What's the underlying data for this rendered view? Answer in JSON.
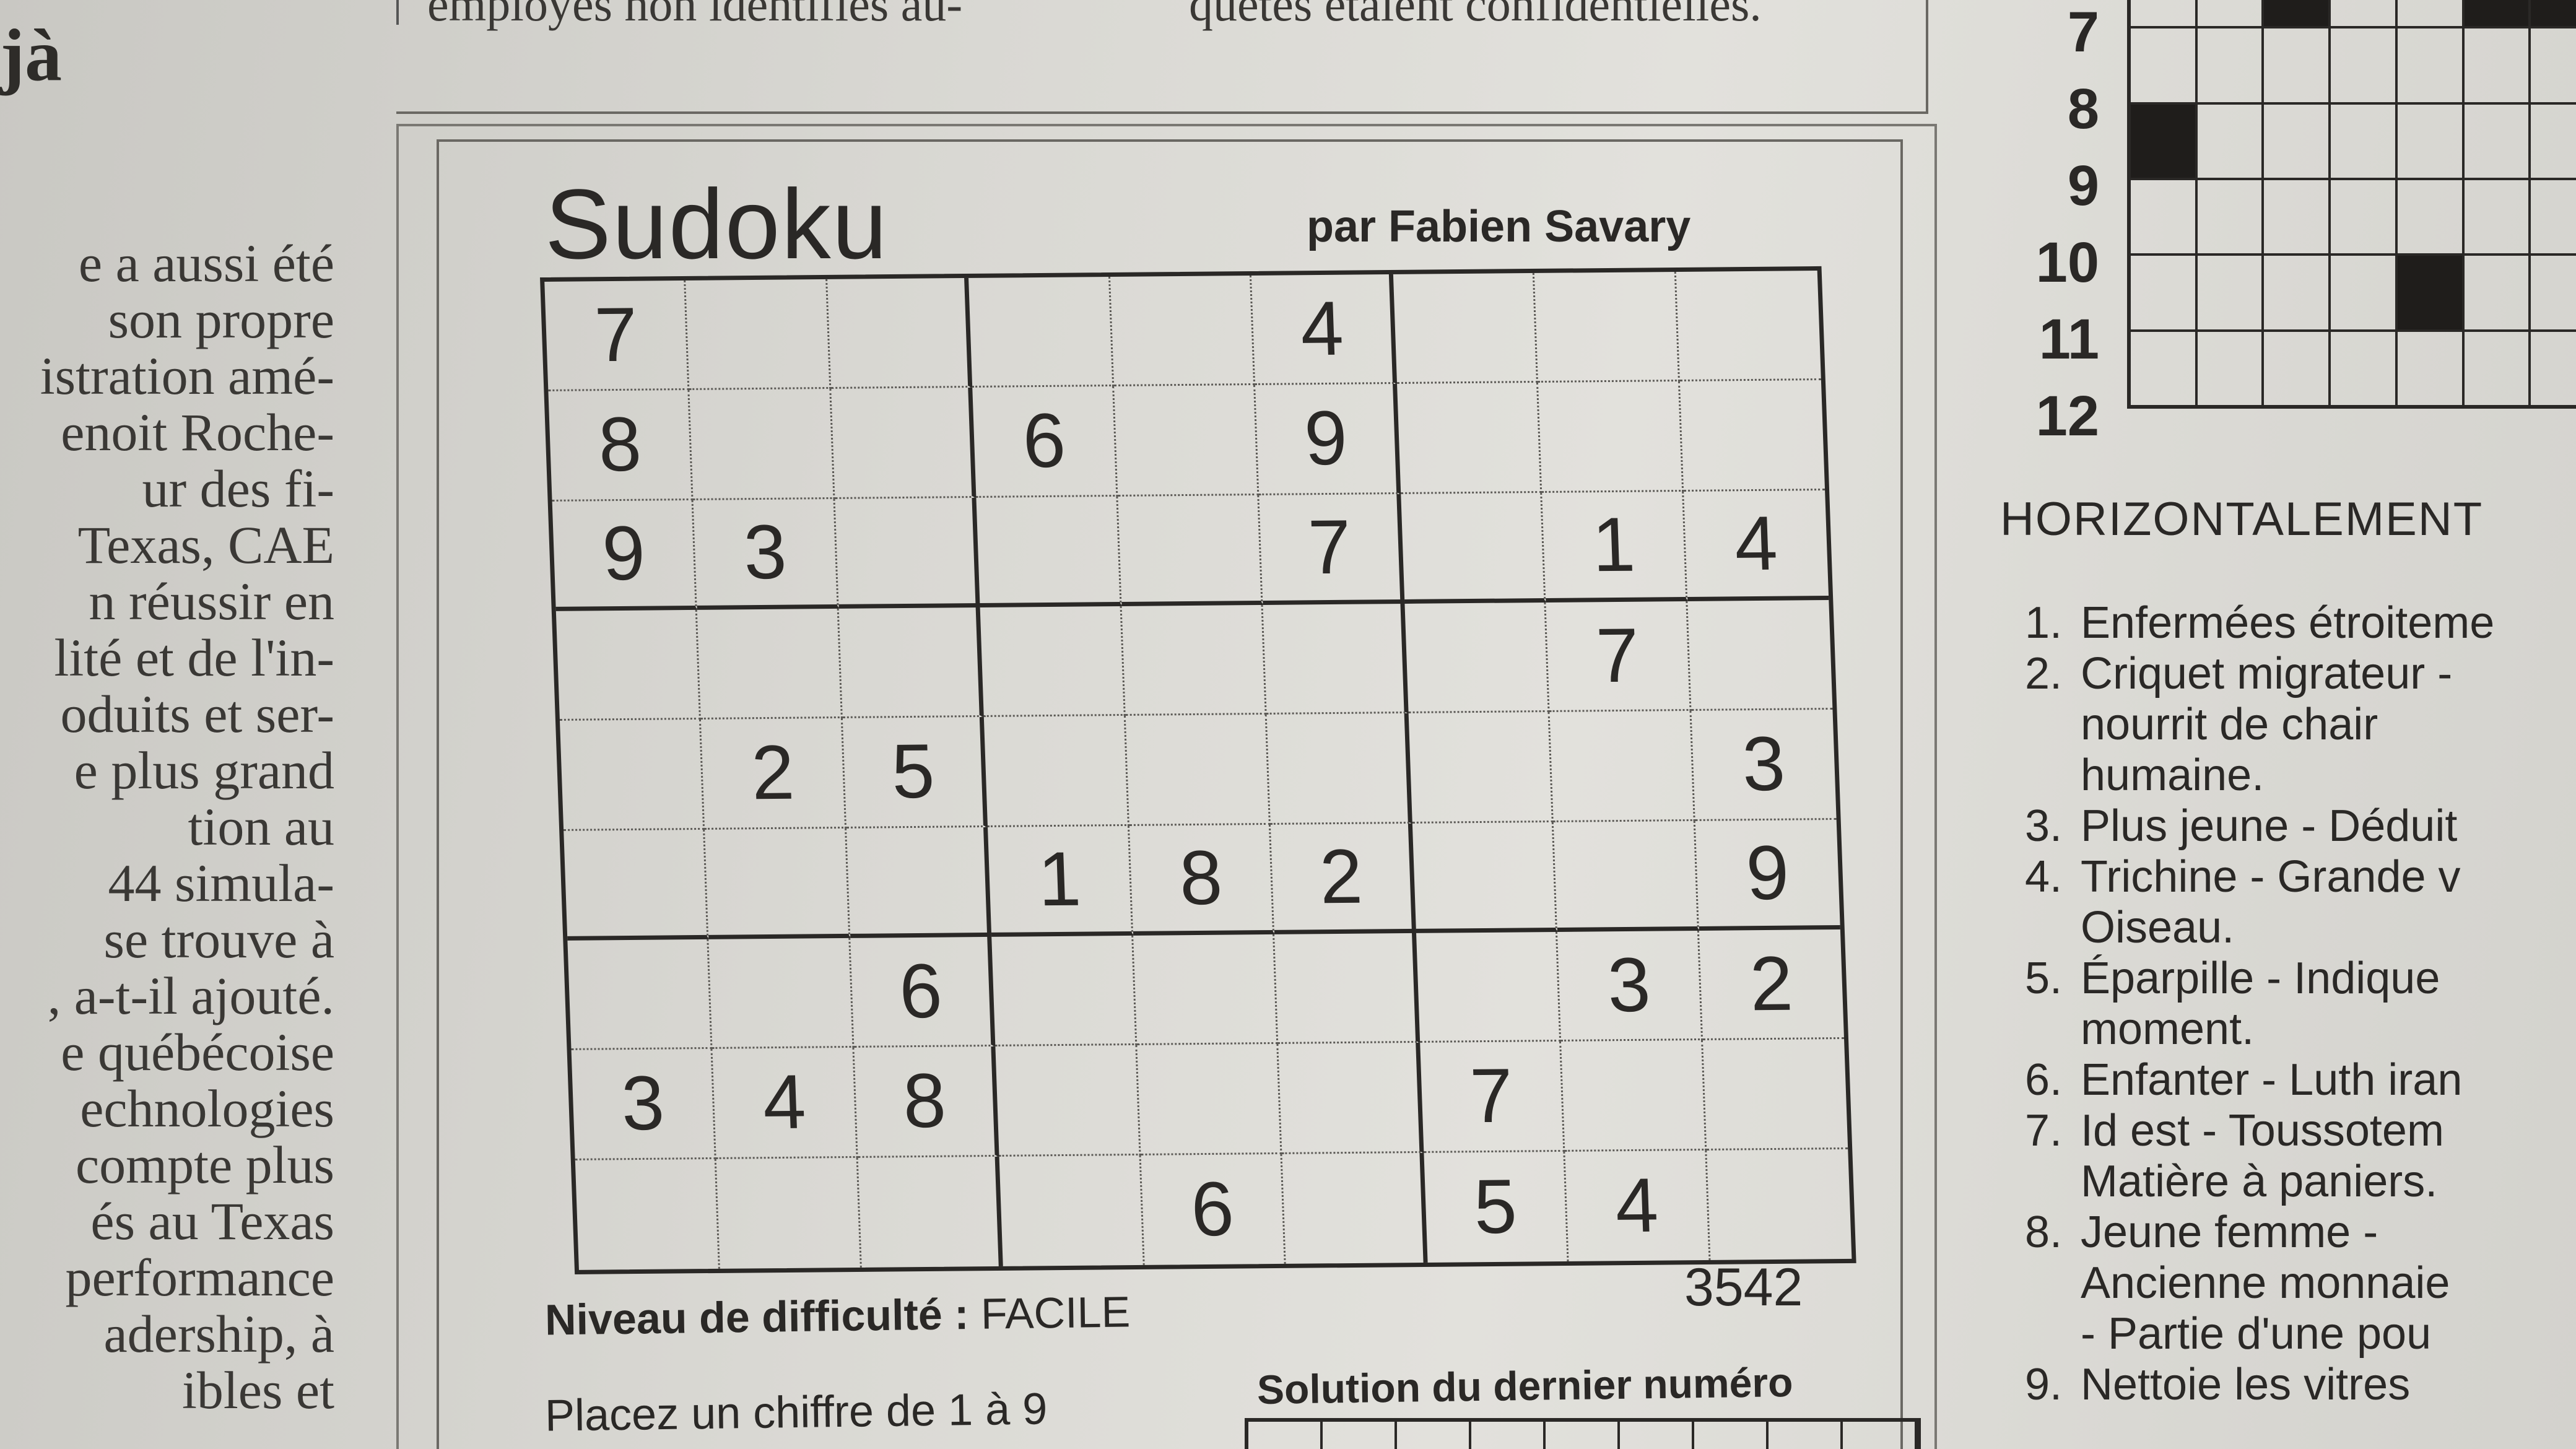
{
  "left_column": {
    "heading_fragment": "jà",
    "lines": [
      "e a aussi été",
      "son propre",
      "istration amé-",
      "enoit Roche-",
      "ur des fi-",
      "Texas, CAE",
      "n réussir en",
      "lité et de l'in-",
      "oduits et ser-",
      "e plus grand",
      "tion au",
      "44 simula-",
      "se trouve à",
      ", a-t-il ajouté.",
      "e québécoise",
      "echnologies",
      "compte plus",
      "és au Texas",
      "performance",
      "adership, à",
      "ibles et"
    ]
  },
  "top_article": {
    "left_fragment": "employés non identifiés au-",
    "right_fragment": "quêtes étaient confidentielles."
  },
  "sudoku": {
    "title": "Sudoku",
    "author": "par Fabien Savary",
    "grid": [
      [
        "7",
        "",
        "",
        "",
        "",
        "4",
        "",
        "",
        ""
      ],
      [
        "8",
        "",
        "",
        "6",
        "",
        "9",
        "",
        "",
        ""
      ],
      [
        "9",
        "3",
        "",
        "",
        "",
        "7",
        "",
        "1",
        "4"
      ],
      [
        "",
        "",
        "",
        "",
        "",
        "",
        "",
        "7",
        ""
      ],
      [
        "",
        "2",
        "5",
        "",
        "",
        "",
        "",
        "",
        "3"
      ],
      [
        "",
        "",
        "",
        "1",
        "8",
        "2",
        "",
        "",
        "9"
      ],
      [
        "",
        "",
        "6",
        "",
        "",
        "",
        "",
        "3",
        "2"
      ],
      [
        "3",
        "4",
        "8",
        "",
        "",
        "",
        "7",
        "",
        ""
      ],
      [
        "",
        "",
        "",
        "",
        "6",
        "",
        "5",
        "4",
        ""
      ]
    ],
    "difficulty_label": "Niveau de difficulté :",
    "difficulty_value": "FACILE",
    "grid_number": "3542",
    "instruction": "Placez un chiffre de 1 à 9",
    "solution_label": "Solution du dernier numéro"
  },
  "crossword": {
    "row_numbers": [
      "7",
      "8",
      "9",
      "10",
      "11",
      "12"
    ],
    "black_cells": [
      [
        0,
        2
      ],
      [
        0,
        5
      ],
      [
        0,
        6
      ],
      [
        2,
        0
      ],
      [
        4,
        4
      ]
    ],
    "section_title": "HORIZONTALEMENT",
    "clues": [
      {
        "num": "1.",
        "text": "Enfermées étroiteme",
        "cont": []
      },
      {
        "num": "2.",
        "text": "Criquet migrateur -",
        "cont": [
          "nourrit de chair",
          "humaine."
        ]
      },
      {
        "num": "3.",
        "text": "Plus jeune - Déduit",
        "cont": []
      },
      {
        "num": "4.",
        "text": "Trichine - Grande v",
        "cont": [
          "Oiseau."
        ]
      },
      {
        "num": "5.",
        "text": "Éparpille - Indique",
        "cont": [
          "moment."
        ]
      },
      {
        "num": "6.",
        "text": "Enfanter - Luth iran",
        "cont": []
      },
      {
        "num": "7.",
        "text": "Id est - Toussotem",
        "cont": [
          "Matière à paniers."
        ]
      },
      {
        "num": "8.",
        "text": "Jeune femme -",
        "cont": [
          "Ancienne monnaie",
          "- Partie d'une pou"
        ]
      },
      {
        "num": "9.",
        "text": "Nettoie les vitres",
        "cont": []
      }
    ]
  }
}
